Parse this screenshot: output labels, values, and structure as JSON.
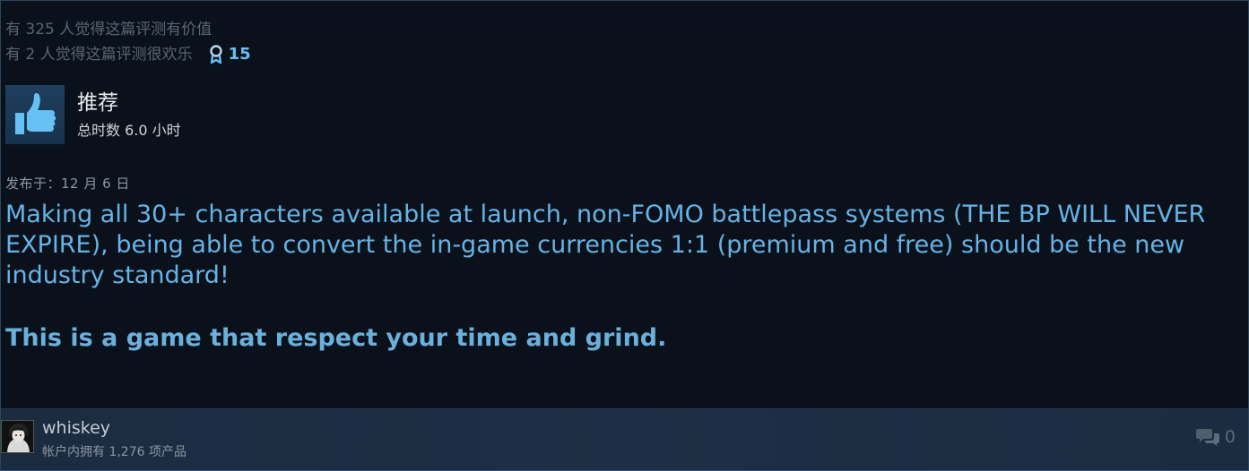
{
  "helpful": {
    "useful_text": "有 325 人觉得这篇评测有价值",
    "funny_text": "有 2 人觉得这篇评测很欢乐",
    "award_count": "15",
    "award_icon": "award-ribbon-icon"
  },
  "vote": {
    "icon": "thumbs-up-icon",
    "title": "推荐",
    "hours": "总时数 6.0 小时"
  },
  "posted": "发布于：12 月 6 日",
  "content": {
    "paragraph": "Making all 30+ characters available at launch, non-FOMO battlepass systems (THE BP WILL NEVER EXPIRE), being able to convert the in-game currencies 1:1 (premium and free) should be the new industry standard!",
    "bold_line": "This is a game that respect your time and grind."
  },
  "author": {
    "name": "whiskey",
    "owned": "帐户内拥有 1,276 项产品",
    "avatar_icon": "avatar-image"
  },
  "comments": {
    "icon": "comment-bubble-icon",
    "count": "0"
  },
  "colors": {
    "background": "#0b111b",
    "accent": "#66c0f4",
    "content_text": "#66b3e6",
    "footer": "#1e2f45"
  }
}
